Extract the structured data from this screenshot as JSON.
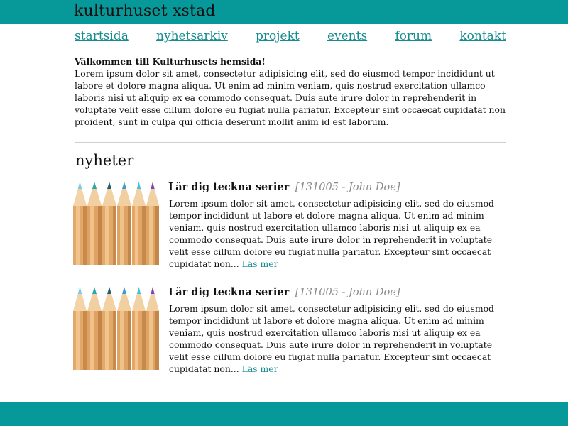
{
  "site": {
    "title": "kulturhuset xstad"
  },
  "nav": {
    "items": [
      "startsida",
      "nyhetsarkiv",
      "projekt",
      "events",
      "forum",
      "kontakt"
    ]
  },
  "intro": {
    "heading": "Välkommen till Kulturhusets hemsida!",
    "text": "Lorem ipsum dolor sit amet, consectetur adipisicing elit, sed do eiusmod tempor incididunt ut labore et dolore magna aliqua. Ut enim ad minim veniam, quis nostrud exercitation ullamco laboris nisi ut aliquip ex ea commodo consequat. Duis aute irure dolor in reprehenderit in voluptate velit esse cillum dolore eu fugiat nulla pariatur. Excepteur sint occaecat cupidatat non proident, sunt in culpa qui officia deserunt mollit anim id est laborum."
  },
  "news": {
    "title": "nyheter",
    "items": [
      {
        "title": "Lär dig teckna serier",
        "meta": "[131005 - John Doe]",
        "text": "Lorem ipsum dolor sit amet, consectetur adipisicing elit, sed do eiusmod tempor incididunt ut labore et dolore magna aliqua. Ut enim ad minim veniam, quis nostrud exercitation ullamco laboris nisi ut aliquip ex ea commodo consequat. Duis aute irure dolor in reprehenderit in voluptate velit esse cillum dolore eu fugiat nulla pariatur. Excepteur sint occaecat cupidatat non...",
        "read_more": "Läs mer"
      },
      {
        "title": "Lär dig teckna serier",
        "meta": "[131005 - John Doe]",
        "text": "Lorem ipsum dolor sit amet, consectetur adipisicing elit, sed do eiusmod tempor incididunt ut labore et dolore magna aliqua. Ut enim ad minim veniam, quis nostrud exercitation ullamco laboris nisi ut aliquip ex ea commodo consequat. Duis aute irure dolor in reprehenderit in voluptate velit esse cillum dolore eu fugiat nulla pariatur. Excepteur sint occaecat cupidatat non...",
        "read_more": "Läs mer"
      }
    ]
  },
  "colors": {
    "brand": "#07999a",
    "link": "#168c8e",
    "meta": "#8a8a8a"
  },
  "icons": {
    "news_thumbnail": "colored-pencils-image"
  }
}
